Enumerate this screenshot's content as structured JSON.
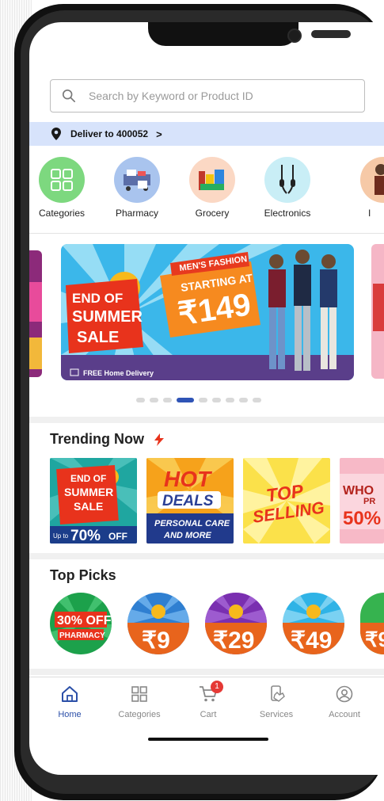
{
  "search": {
    "placeholder": "Search by Keyword or Product ID"
  },
  "delivery": {
    "label": "Deliver to 400052",
    "chevron": ">"
  },
  "categories": [
    {
      "label": "Categories",
      "icon": "grid-icon"
    },
    {
      "label": "Pharmacy",
      "icon": "pharmacy-icon"
    },
    {
      "label": "Grocery",
      "icon": "grocery-icon"
    },
    {
      "label": "Electronics",
      "icon": "earphones-icon"
    },
    {
      "label": "I",
      "icon": "fashion-icon"
    }
  ],
  "banner": {
    "tag": "MEN'S FASHION",
    "line1": "STARTING AT",
    "price": "₹149",
    "sale1": "END OF",
    "sale2": "SUMMER",
    "sale3": "SALE",
    "delivery_note": "FREE Home Delivery"
  },
  "carousel": {
    "count": 9,
    "active_index": 3
  },
  "trending": {
    "title": "Trending Now",
    "tiles": [
      {
        "l1": "END OF",
        "l2": "SUMMER",
        "l3": "SALE",
        "pre": "Up to",
        "big": "70%",
        "post": "OFF"
      },
      {
        "l1": "HOT",
        "l2": "DEALS",
        "l3": "PERSONAL CARE",
        "l4": "AND MORE"
      },
      {
        "l1": "TOP",
        "l2": "SELLING"
      },
      {
        "l1": "WHO",
        "l2": "PR",
        "l3": "50%"
      }
    ]
  },
  "top_picks": {
    "title": "Top Picks",
    "items": [
      {
        "l1": "30% OFF",
        "l2": "PHARMACY"
      },
      {
        "label": "₹9"
      },
      {
        "label": "₹29"
      },
      {
        "label": "₹49"
      },
      {
        "label": "₹9"
      }
    ]
  },
  "nav": [
    {
      "label": "Home",
      "icon": "home-icon"
    },
    {
      "label": "Categories",
      "icon": "grid-icon"
    },
    {
      "label": "Cart",
      "icon": "cart-icon",
      "badge": "1"
    },
    {
      "label": "Services",
      "icon": "services-icon"
    },
    {
      "label": "Account",
      "icon": "account-icon"
    }
  ]
}
